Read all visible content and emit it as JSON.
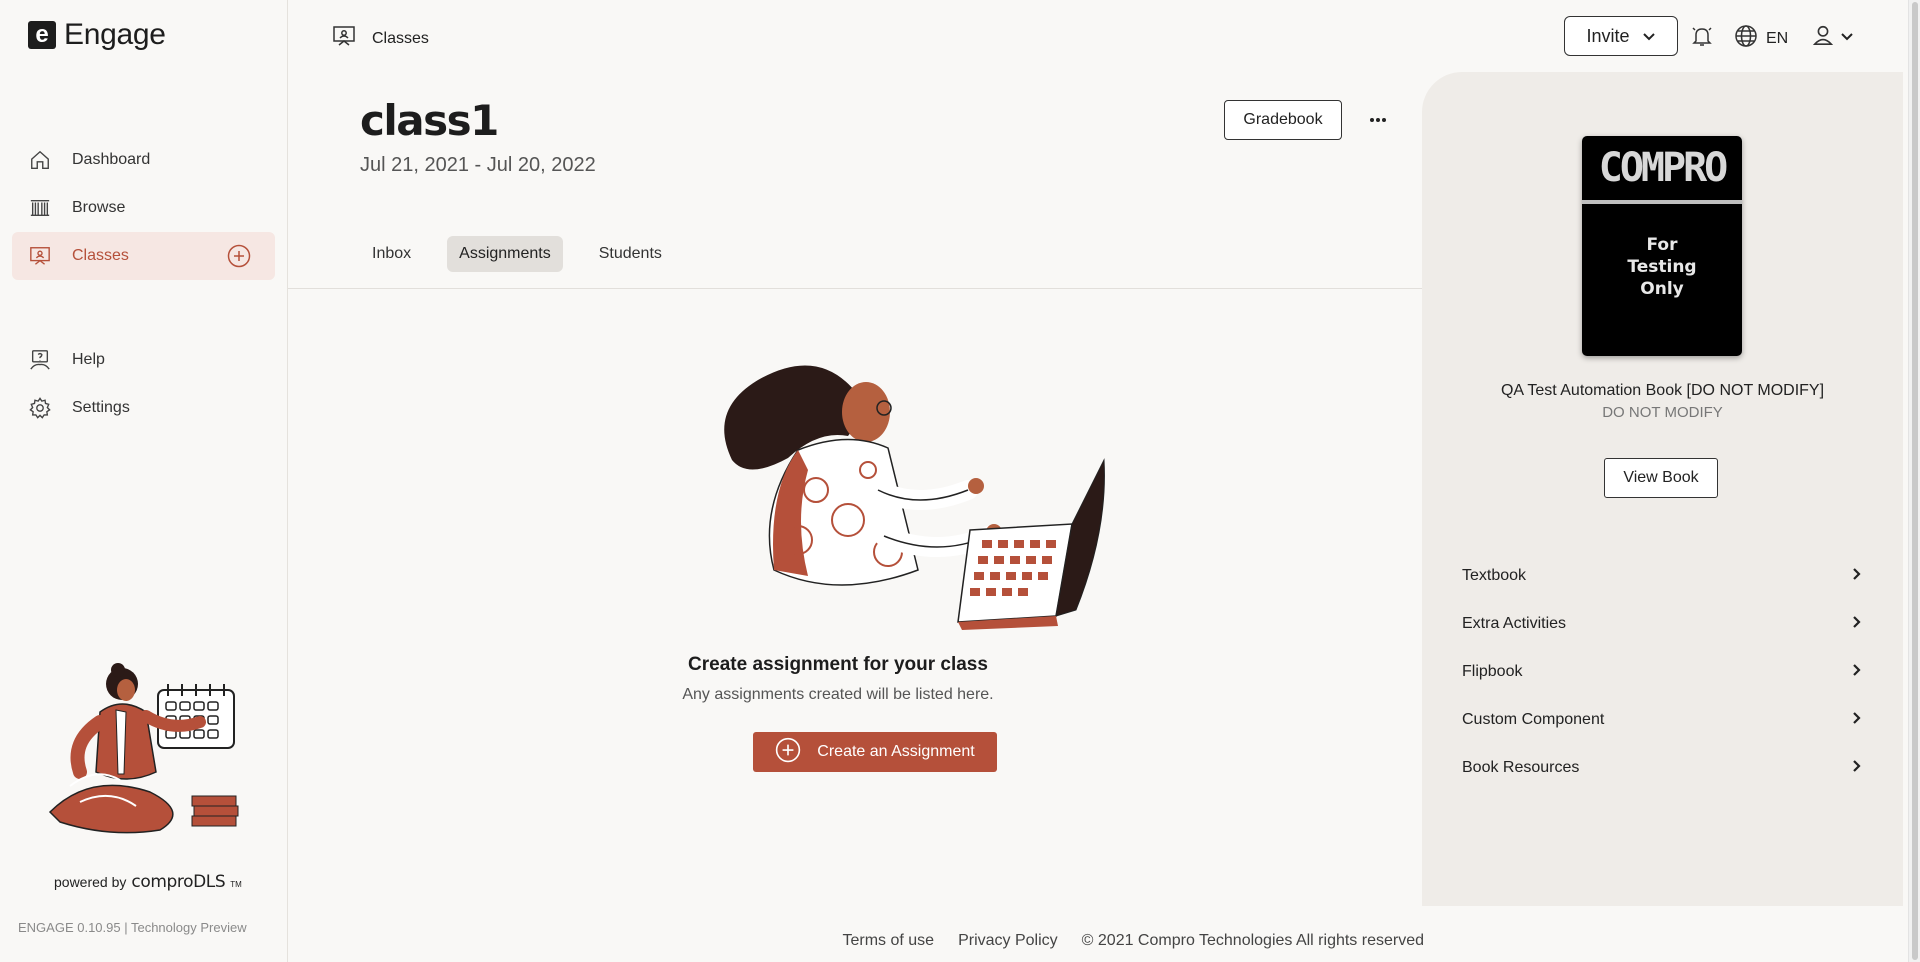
{
  "app": {
    "logo_letter": "e",
    "name": "Engage"
  },
  "sidebar": {
    "items": [
      {
        "label": "Dashboard",
        "icon": "home-icon"
      },
      {
        "label": "Browse",
        "icon": "library-icon"
      },
      {
        "label": "Classes",
        "icon": "classroom-icon",
        "active": true
      },
      {
        "label": "Help",
        "icon": "help-icon"
      },
      {
        "label": "Settings",
        "icon": "gear-icon"
      }
    ],
    "powered_by": "powered by",
    "brand": "comproDLS",
    "trademark": "TM",
    "version": "ENGAGE 0.10.95 | Technology Preview"
  },
  "header": {
    "breadcrumb": "Classes",
    "invite_label": "Invite",
    "language": "EN"
  },
  "class": {
    "title": "class1",
    "dates": "Jul 21, 2021 - Jul 20, 2022",
    "gradebook_label": "Gradebook"
  },
  "tabs": [
    {
      "label": "Inbox"
    },
    {
      "label": "Assignments",
      "active": true
    },
    {
      "label": "Students"
    }
  ],
  "empty_state": {
    "title": "Create assignment for your class",
    "subtitle": "Any assignments created will be listed here.",
    "button": "Create an Assignment"
  },
  "book": {
    "cover_brand": "COMPRO",
    "cover_line1": "For",
    "cover_line2": "Testing",
    "cover_line3": "Only",
    "title": "QA Test Automation Book [DO NOT MODIFY]",
    "subtitle": "DO NOT MODIFY",
    "view_label": "View Book",
    "resources": [
      {
        "label": "Textbook"
      },
      {
        "label": "Extra Activities"
      },
      {
        "label": "Flipbook"
      },
      {
        "label": "Custom Component"
      },
      {
        "label": "Book Resources"
      }
    ]
  },
  "footer": {
    "terms": "Terms of use",
    "privacy": "Privacy Policy",
    "copyright": "© 2021 Compro Technologies All rights reserved"
  },
  "colors": {
    "accent": "#b5503a",
    "active_bg": "#f6e7e3",
    "panel_bg": "#efece8"
  }
}
